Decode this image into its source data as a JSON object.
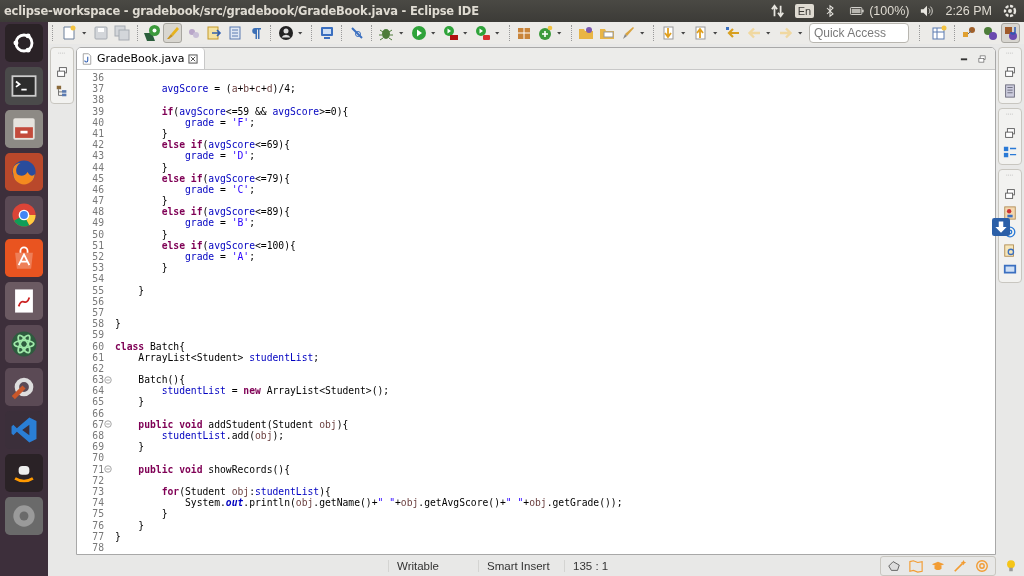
{
  "top_panel": {
    "title": "eclipse-workspace - gradebook/src/gradebook/GradeBook.java - Eclipse IDE",
    "keyboard": "En",
    "battery": "(100%)",
    "clock": "2:26 PM"
  },
  "toolbar": {
    "groups": [
      [
        {
          "kind": "new",
          "pressed": false,
          "dropdown": true
        },
        {
          "kind": "save",
          "pressed": false,
          "dropdown": false
        },
        {
          "kind": "saveall",
          "pressed": false,
          "dropdown": false
        }
      ],
      [
        {
          "kind": "tool",
          "pressed": false,
          "dropdown": false
        },
        {
          "kind": "brush",
          "pressed": true,
          "dropdown": false
        },
        {
          "kind": "dots",
          "pressed": false,
          "dropdown": false
        },
        {
          "kind": "opentype",
          "pressed": false,
          "dropdown": false
        },
        {
          "kind": "outline",
          "pressed": false,
          "dropdown": false
        },
        {
          "kind": "pilcrow",
          "pressed": false,
          "dropdown": false
        }
      ],
      [
        {
          "kind": "person",
          "pressed": false,
          "dropdown": true
        }
      ],
      [
        {
          "kind": "monitor",
          "pressed": false,
          "dropdown": false
        }
      ],
      [
        {
          "kind": "pen",
          "pressed": false,
          "dropdown": false
        }
      ],
      [
        {
          "kind": "bug",
          "pressed": false,
          "dropdown": true
        },
        {
          "kind": "run",
          "pressed": false,
          "dropdown": true
        },
        {
          "kind": "coverage",
          "pressed": false,
          "dropdown": true
        },
        {
          "kind": "exttools",
          "pressed": false,
          "dropdown": true
        }
      ],
      [
        {
          "kind": "package",
          "pressed": false,
          "dropdown": false
        },
        {
          "kind": "newclass",
          "pressed": false,
          "dropdown": true
        }
      ],
      [
        {
          "kind": "folder",
          "pressed": false,
          "dropdown": false
        },
        {
          "kind": "folder2",
          "pressed": false,
          "dropdown": false
        },
        {
          "kind": "rocket",
          "pressed": false,
          "dropdown": true
        }
      ],
      [
        {
          "kind": "nextann",
          "pressed": false,
          "dropdown": true
        },
        {
          "kind": "prevann",
          "pressed": false,
          "dropdown": true
        },
        {
          "kind": "lastedit",
          "pressed": false,
          "dropdown": false
        },
        {
          "kind": "back",
          "pressed": false,
          "dropdown": true
        },
        {
          "kind": "forward",
          "pressed": false,
          "dropdown": true
        }
      ]
    ]
  },
  "quick_access": {
    "placeholder": "Quick Access"
  },
  "perspectives": [
    {
      "kind": "open",
      "selected": false
    },
    {
      "kind": "team",
      "selected": false
    },
    {
      "kind": "debug",
      "selected": false
    },
    {
      "kind": "java",
      "selected": true
    }
  ],
  "editor_tabs": [
    {
      "label": "GradeBook.java",
      "selected": true
    }
  ],
  "code_lines": [
    {
      "number": "36",
      "fold_marker": false
    },
    {
      "number": "37",
      "fold_marker": false,
      "tokens": [
        {
          "kind": "field",
          "text": "        avgScore"
        },
        {
          "kind": "plain",
          "text": " = ("
        },
        {
          "kind": "local",
          "text": "a"
        },
        {
          "kind": "plain",
          "text": "+"
        },
        {
          "kind": "local",
          "text": "b"
        },
        {
          "kind": "plain",
          "text": "+"
        },
        {
          "kind": "local",
          "text": "c"
        },
        {
          "kind": "plain",
          "text": "+"
        },
        {
          "kind": "local",
          "text": "d"
        },
        {
          "kind": "plain",
          "text": ")/4;"
        }
      ]
    },
    {
      "number": "38",
      "fold_marker": false
    },
    {
      "number": "39",
      "fold_marker": false,
      "tokens": [
        {
          "kind": "keyword",
          "text": "        if"
        },
        {
          "kind": "plain",
          "text": "("
        },
        {
          "kind": "field",
          "text": "avgScore"
        },
        {
          "kind": "plain",
          "text": "<=59 && "
        },
        {
          "kind": "field",
          "text": "avgScore"
        },
        {
          "kind": "plain",
          "text": ">=0){"
        }
      ]
    },
    {
      "number": "40",
      "fold_marker": false,
      "tokens": [
        {
          "kind": "field",
          "text": "            grade"
        },
        {
          "kind": "plain",
          "text": " = "
        },
        {
          "kind": "string",
          "text": "'F'"
        },
        {
          "kind": "plain",
          "text": ";"
        }
      ]
    },
    {
      "number": "41",
      "fold_marker": false,
      "tokens": [
        {
          "kind": "plain",
          "text": "        }"
        }
      ]
    },
    {
      "number": "42",
      "fold_marker": false,
      "tokens": [
        {
          "kind": "keyword",
          "text": "        else if"
        },
        {
          "kind": "plain",
          "text": "("
        },
        {
          "kind": "field",
          "text": "avgScore"
        },
        {
          "kind": "plain",
          "text": "<=69){"
        }
      ]
    },
    {
      "number": "43",
      "fold_marker": false,
      "tokens": [
        {
          "kind": "field",
          "text": "            grade"
        },
        {
          "kind": "plain",
          "text": " = "
        },
        {
          "kind": "string",
          "text": "'D'"
        },
        {
          "kind": "plain",
          "text": ";"
        }
      ]
    },
    {
      "number": "44",
      "fold_marker": false,
      "tokens": [
        {
          "kind": "plain",
          "text": "        }"
        }
      ]
    },
    {
      "number": "45",
      "fold_marker": false,
      "tokens": [
        {
          "kind": "keyword",
          "text": "        else if"
        },
        {
          "kind": "plain",
          "text": "("
        },
        {
          "kind": "field",
          "text": "avgScore"
        },
        {
          "kind": "plain",
          "text": "<=79){"
        }
      ]
    },
    {
      "number": "46",
      "fold_marker": false,
      "tokens": [
        {
          "kind": "field",
          "text": "            grade"
        },
        {
          "kind": "plain",
          "text": " = "
        },
        {
          "kind": "string",
          "text": "'C'"
        },
        {
          "kind": "plain",
          "text": ";"
        }
      ]
    },
    {
      "number": "47",
      "fold_marker": false,
      "tokens": [
        {
          "kind": "plain",
          "text": "        }"
        }
      ]
    },
    {
      "number": "48",
      "fold_marker": false,
      "tokens": [
        {
          "kind": "keyword",
          "text": "        else if"
        },
        {
          "kind": "plain",
          "text": "("
        },
        {
          "kind": "field",
          "text": "avgScore"
        },
        {
          "kind": "plain",
          "text": "<=89){"
        }
      ]
    },
    {
      "number": "49",
      "fold_marker": false,
      "tokens": [
        {
          "kind": "field",
          "text": "            grade"
        },
        {
          "kind": "plain",
          "text": " = "
        },
        {
          "kind": "string",
          "text": "'B'"
        },
        {
          "kind": "plain",
          "text": ";"
        }
      ]
    },
    {
      "number": "50",
      "fold_marker": false,
      "tokens": [
        {
          "kind": "plain",
          "text": "        }"
        }
      ]
    },
    {
      "number": "51",
      "fold_marker": false,
      "tokens": [
        {
          "kind": "keyword",
          "text": "        else if"
        },
        {
          "kind": "plain",
          "text": "("
        },
        {
          "kind": "field",
          "text": "avgScore"
        },
        {
          "kind": "plain",
          "text": "<=100){"
        }
      ]
    },
    {
      "number": "52",
      "fold_marker": false,
      "tokens": [
        {
          "kind": "field",
          "text": "            grade"
        },
        {
          "kind": "plain",
          "text": " = "
        },
        {
          "kind": "string",
          "text": "'A'"
        },
        {
          "kind": "plain",
          "text": ";"
        }
      ]
    },
    {
      "number": "53",
      "fold_marker": false,
      "tokens": [
        {
          "kind": "plain",
          "text": "        }"
        }
      ]
    },
    {
      "number": "54",
      "fold_marker": false
    },
    {
      "number": "55",
      "fold_marker": false,
      "tokens": [
        {
          "kind": "plain",
          "text": "    }"
        }
      ]
    },
    {
      "number": "56",
      "fold_marker": false
    },
    {
      "number": "57",
      "fold_marker": false
    },
    {
      "number": "58",
      "fold_marker": false,
      "tokens": [
        {
          "kind": "plain",
          "text": "}"
        }
      ]
    },
    {
      "number": "59",
      "fold_marker": false
    },
    {
      "number": "60",
      "fold_marker": false,
      "tokens": [
        {
          "kind": "keyword",
          "text": "class"
        },
        {
          "kind": "plain",
          "text": " Batch{"
        }
      ]
    },
    {
      "number": "61",
      "fold_marker": false,
      "tokens": [
        {
          "kind": "plain",
          "text": "    ArrayList<Student> "
        },
        {
          "kind": "field",
          "text": "studentList"
        },
        {
          "kind": "plain",
          "text": ";"
        }
      ]
    },
    {
      "number": "62",
      "fold_marker": false
    },
    {
      "number": "63",
      "fold_marker": true,
      "tokens": [
        {
          "kind": "plain",
          "text": "    Batch(){"
        }
      ]
    },
    {
      "number": "64",
      "fold_marker": false,
      "tokens": [
        {
          "kind": "field",
          "text": "        studentList"
        },
        {
          "kind": "plain",
          "text": " = "
        },
        {
          "kind": "keyword",
          "text": "new"
        },
        {
          "kind": "plain",
          "text": " ArrayList<Student>();"
        }
      ]
    },
    {
      "number": "65",
      "fold_marker": false,
      "tokens": [
        {
          "kind": "plain",
          "text": "    }"
        }
      ]
    },
    {
      "number": "66",
      "fold_marker": false
    },
    {
      "number": "67",
      "fold_marker": true,
      "tokens": [
        {
          "kind": "keyword",
          "text": "    public void"
        },
        {
          "kind": "plain",
          "text": " addStudent(Student "
        },
        {
          "kind": "local",
          "text": "obj"
        },
        {
          "kind": "plain",
          "text": "){"
        }
      ]
    },
    {
      "number": "68",
      "fold_marker": false,
      "tokens": [
        {
          "kind": "field",
          "text": "        studentList"
        },
        {
          "kind": "plain",
          "text": ".add("
        },
        {
          "kind": "local",
          "text": "obj"
        },
        {
          "kind": "plain",
          "text": ");"
        }
      ]
    },
    {
      "number": "69",
      "fold_marker": false,
      "tokens": [
        {
          "kind": "plain",
          "text": "    }"
        }
      ]
    },
    {
      "number": "70",
      "fold_marker": false
    },
    {
      "number": "71",
      "fold_marker": true,
      "tokens": [
        {
          "kind": "keyword",
          "text": "    public void"
        },
        {
          "kind": "plain",
          "text": " showRecords(){"
        }
      ]
    },
    {
      "number": "72",
      "fold_marker": false
    },
    {
      "number": "73",
      "fold_marker": false,
      "tokens": [
        {
          "kind": "keyword",
          "text": "        for"
        },
        {
          "kind": "plain",
          "text": "(Student "
        },
        {
          "kind": "local",
          "text": "obj"
        },
        {
          "kind": "plain",
          "text": ":"
        },
        {
          "kind": "field",
          "text": "studentList"
        },
        {
          "kind": "plain",
          "text": "){"
        }
      ]
    },
    {
      "number": "74",
      "fold_marker": false,
      "tokens": [
        {
          "kind": "plain",
          "text": "            System."
        },
        {
          "kind": "static",
          "text": "out"
        },
        {
          "kind": "plain",
          "text": ".println("
        },
        {
          "kind": "local",
          "text": "obj"
        },
        {
          "kind": "plain",
          "text": ".getName()+"
        },
        {
          "kind": "string",
          "text": "\" \""
        },
        {
          "kind": "plain",
          "text": "+"
        },
        {
          "kind": "local",
          "text": "obj"
        },
        {
          "kind": "plain",
          "text": ".getAvgScore()+"
        },
        {
          "kind": "string",
          "text": "\" \""
        },
        {
          "kind": "plain",
          "text": "+"
        },
        {
          "kind": "local",
          "text": "obj"
        },
        {
          "kind": "plain",
          "text": ".getGrade());"
        }
      ]
    },
    {
      "number": "75",
      "fold_marker": false,
      "tokens": [
        {
          "kind": "plain",
          "text": "        }"
        }
      ]
    },
    {
      "number": "76",
      "fold_marker": false,
      "tokens": [
        {
          "kind": "plain",
          "text": "    }"
        }
      ]
    },
    {
      "number": "77",
      "fold_marker": false,
      "tokens": [
        {
          "kind": "plain",
          "text": "}"
        }
      ]
    },
    {
      "number": "78",
      "fold_marker": false
    }
  ],
  "status_bar": {
    "mode": "Writable",
    "insert_mode": "Smart Insert",
    "position": "135 : 1"
  }
}
